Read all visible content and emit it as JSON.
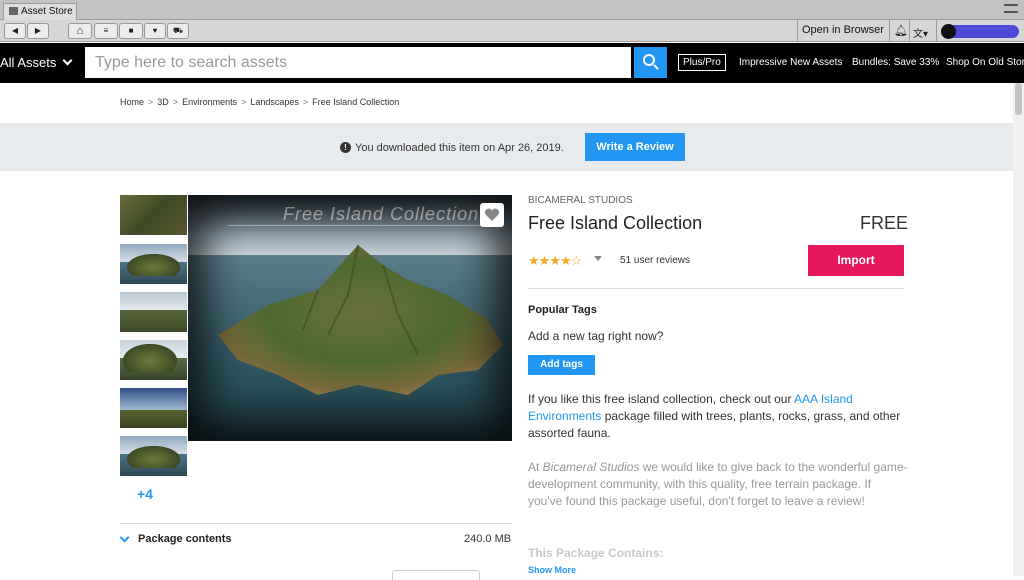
{
  "window": {
    "tab_title": "Asset Store"
  },
  "toolbar": {
    "back_label": "◀",
    "forward_label": "▶",
    "home_label": "⌂",
    "open_in_browser": "Open in Browser"
  },
  "nav": {
    "category": "All Assets",
    "search_placeholder": "Type here to search assets",
    "plus_pro": "Plus/Pro",
    "links": [
      "Impressive New Assets",
      "Bundles: Save 33%",
      "Shop On Old Store"
    ]
  },
  "breadcrumb": [
    "Home",
    "3D",
    "Environments",
    "Landscapes",
    "Free Island Collection"
  ],
  "banner": {
    "message": "You downloaded this item on Apr 26, 2019.",
    "button": "Write a Review"
  },
  "gallery": {
    "main_image_title": "Free Island Collection",
    "more_count": "+4"
  },
  "package": {
    "label": "Package contents",
    "size": "240.0 MB"
  },
  "asset": {
    "publisher": "BICAMERAL STUDIOS",
    "title": "Free Island Collection",
    "price": "FREE",
    "rating": 4,
    "rating_max": 5,
    "reviews": "51 user reviews",
    "import_label": "Import"
  },
  "tags": {
    "heading": "Popular Tags",
    "prompt": "Add a new tag right now?",
    "button": "Add tags"
  },
  "description": {
    "p1_before": "If you like this free island collection, check out our ",
    "p1_link": "AAA Island Environments",
    "p1_after": " package filled with trees, plants, rocks, grass, and other assorted fauna.",
    "p2_before": "At ",
    "p2_italic": "Bicameral Studios",
    "p2_after": " we would like to give back to the wonderful game-development community, with this quality, free terrain package. If you've found this package useful, don't forget to leave a review!",
    "p3": "This Package Contains:",
    "show_more": "Show More"
  },
  "colors": {
    "accent": "#2196f3",
    "import": "#e6175d",
    "star": "#f5a623",
    "nav_bg": "#000000"
  }
}
